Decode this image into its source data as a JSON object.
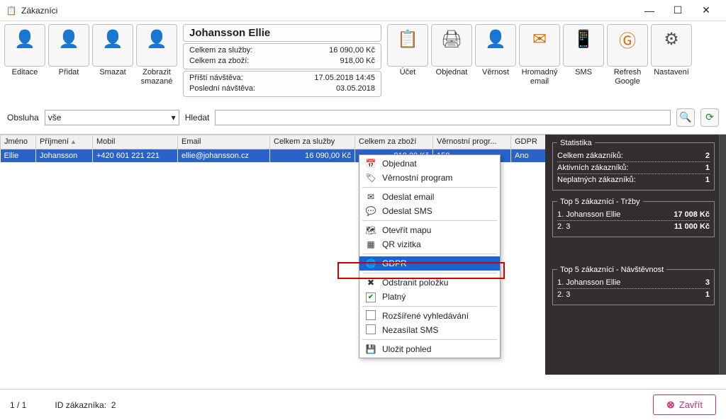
{
  "window": {
    "title": "Zákazníci"
  },
  "toolbar": {
    "left": [
      {
        "key": "edit",
        "label": "Editace",
        "icon": "person-edit",
        "color": "orange"
      },
      {
        "key": "add",
        "label": "Přidat",
        "icon": "person-plus",
        "color": "green"
      },
      {
        "key": "delete",
        "label": "Smazat",
        "icon": "person-x",
        "color": "red"
      },
      {
        "key": "showdel",
        "label": "Zobrazit\nsmazané",
        "icon": "person-search",
        "color": "orange"
      }
    ],
    "right": [
      {
        "key": "account",
        "label": "Účet",
        "icon": "clipboard",
        "color": "orange"
      },
      {
        "key": "order",
        "label": "Objednat",
        "icon": "printer-plus",
        "color": "gray"
      },
      {
        "key": "loyalty",
        "label": "Věrnost",
        "icon": "person-star",
        "color": "orange"
      },
      {
        "key": "bulkmail",
        "label": "Hromadný\nemail",
        "icon": "mail-send",
        "color": "orange"
      },
      {
        "key": "sms",
        "label": "SMS",
        "icon": "device-sms",
        "color": "orange"
      },
      {
        "key": "refresh",
        "label": "Refresh\nGoogle",
        "icon": "google",
        "color": "orange"
      },
      {
        "key": "settings",
        "label": "Nastavení",
        "icon": "gears",
        "color": "gray"
      }
    ]
  },
  "customer_card": {
    "name": "Johansson Ellie",
    "rows1": [
      {
        "label": "Celkem za služby:",
        "value": "16 090,00 Kč"
      },
      {
        "label": "Celkem za zboží:",
        "value": "918,00 Kč"
      }
    ],
    "rows2": [
      {
        "label": "Příští návštěva:",
        "value": "17.05.2018 14:45"
      },
      {
        "label": "Poslední návštěva:",
        "value": "03.05.2018"
      }
    ]
  },
  "filter": {
    "obsluha_label": "Obsluha",
    "obsluha_value": "vše",
    "search_label": "Hledat",
    "search_value": ""
  },
  "grid": {
    "columns": [
      "Jméno",
      "Příjmení",
      "Mobil",
      "Email",
      "Celkem za služby",
      "Celkem za zboží",
      "Věrnostní progr...",
      "GDPR"
    ],
    "sort_col_index": 1,
    "rows": [
      {
        "jmeno": "Ellie",
        "prijmeni": "Johansson",
        "mobil": "+420 601 221 221",
        "email": "ellie@johansson.cz",
        "sluzby": "16 090,00 Kč",
        "zbozi": "918,00 Kč",
        "vernost": "158",
        "gdpr": "Ano"
      }
    ]
  },
  "context_menu": {
    "items": [
      {
        "icon": "calendar",
        "label": "Objednat"
      },
      {
        "icon": "loyalty",
        "label": "Věrnostní program"
      },
      {
        "sep": true
      },
      {
        "icon": "mail",
        "label": "Odeslat email"
      },
      {
        "icon": "sms",
        "label": "Odeslat SMS"
      },
      {
        "sep": true
      },
      {
        "icon": "map",
        "label": "Otevřít mapu"
      },
      {
        "icon": "qr",
        "label": "QR vizitka"
      },
      {
        "sep": true
      },
      {
        "icon": "globe",
        "label": "GDPR",
        "selected": true
      },
      {
        "sep": true
      },
      {
        "icon": "remove",
        "label": "Odstranit položku"
      },
      {
        "icon": "check-on",
        "label": "Platný"
      },
      {
        "sep": true
      },
      {
        "icon": "check-off",
        "label": "Rozšířené vyhledávání"
      },
      {
        "icon": "check-off",
        "label": "Nezasílat SMS"
      },
      {
        "sep": true
      },
      {
        "icon": "save",
        "label": "Uložit pohled"
      }
    ]
  },
  "stats": {
    "title": "Statistika",
    "rows": [
      {
        "label": "Celkem zákazníků:",
        "value": "2"
      },
      {
        "label": "Aktivních zákazníků:",
        "value": "1"
      },
      {
        "label": "Neplatných zákazníků:",
        "value": "1"
      }
    ]
  },
  "top_revenue": {
    "title": "Top 5 zákazníci - Tržby",
    "rows": [
      {
        "label": "1. Johansson Ellie",
        "value": "17 008 Kč"
      },
      {
        "label": "2. 3",
        "value": "11 000 Kč"
      }
    ]
  },
  "top_visits": {
    "title": "Top 5 zákazníci - Návštěvnost",
    "rows": [
      {
        "label": "1. Johansson Ellie",
        "value": "3"
      },
      {
        "label": "2. 3",
        "value": "1"
      }
    ]
  },
  "footer": {
    "page": "1 / 1",
    "id_label": "ID zákazníka:",
    "id_value": "2",
    "close": "Zavřít"
  }
}
